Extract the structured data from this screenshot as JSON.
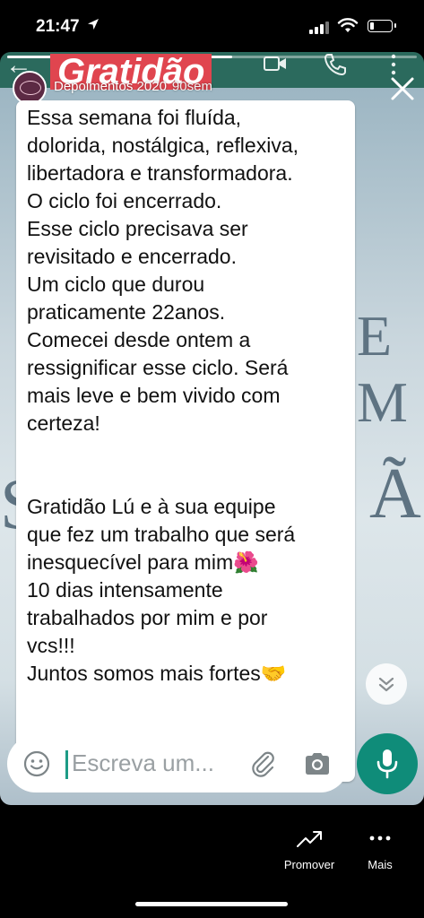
{
  "status_bar": {
    "time": "21:47",
    "location_icon": "location-arrow-icon",
    "signal_icon": "cell-signal-icon",
    "wifi_icon": "wifi-icon",
    "battery_icon": "battery-icon",
    "battery_level": 0.2
  },
  "story": {
    "progress": 0.55,
    "header_title": "Gratidão",
    "account_name": "Depoimentos 2020",
    "time_ago": "90sem",
    "background_letters": [
      "E M",
      "S",
      "Ã"
    ],
    "colors": {
      "header_red": "#e0454f",
      "whatsapp_green": "#0f8c79",
      "bubble": "#ffffff"
    }
  },
  "message": {
    "text": "Essa semana foi fluída,\ndolorida, nostálgica, reflexiva,\nlibertadora e transformadora.\nO ciclo foi encerrado.\nEsse ciclo precisava ser\nrevisitado e encerrado.\nUm ciclo que durou\npraticamente 22anos.\nComecei desde ontem a\nressignificar esse ciclo. Será\nmais leve e bem vivido com\ncerteza!\n\n\nGratidão Lú e à sua equipe\nque fez um trabalho que será\ninesquecível para mim🌺\n10 dias intensamente\ntrabalhados por mim e por\nvcs!!!\nJuntos somos mais fortes🤝",
    "trailing_emojis": "👊 🙏 💞"
  },
  "input": {
    "placeholder": "Escreva um..."
  },
  "bottom_bar": {
    "promote_label": "Promover",
    "more_label": "Mais"
  }
}
